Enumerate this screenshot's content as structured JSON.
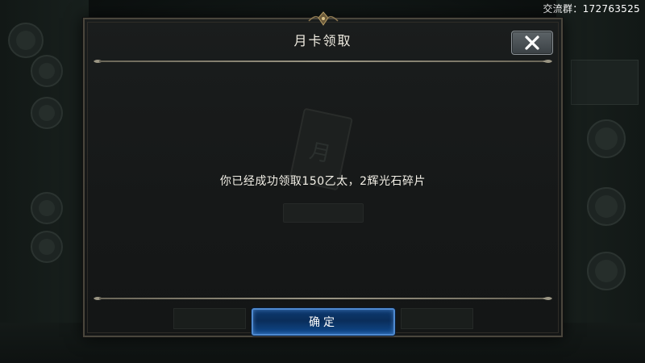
{
  "overlay": {
    "qq_group_text": "交流群：172763525"
  },
  "dialog": {
    "title": "月卡领取",
    "close_icon": "close-icon",
    "message": "你已经成功领取150乙太，2辉光石碎片",
    "confirm_label": "确定"
  },
  "colors": {
    "dialog_border": "#4a463c",
    "confirm_fill": "#0d3a70",
    "confirm_border": "#4f8ad0",
    "divider": "#9b9684"
  }
}
